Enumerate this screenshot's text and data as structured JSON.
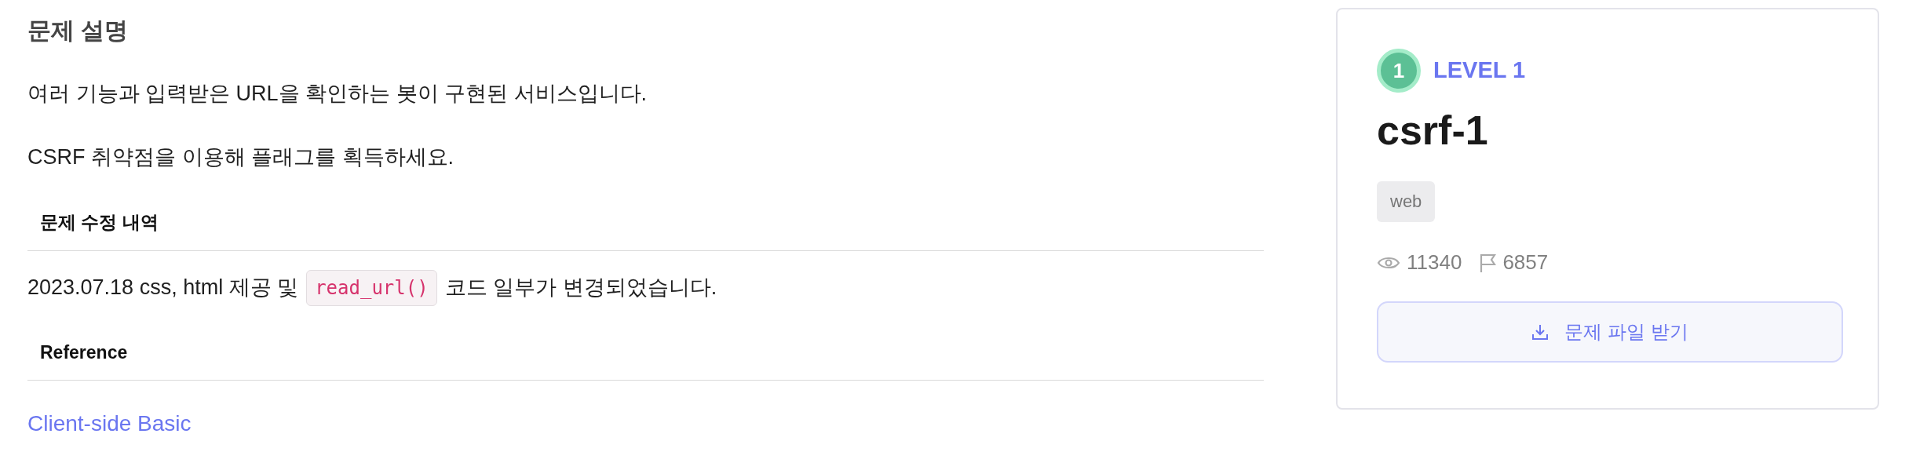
{
  "description": {
    "title": "문제 설명",
    "paragraphs": [
      "여러 기능과 입력받은 URL을 확인하는 봇이 구현된 서비스입니다.",
      "CSRF 취약점을 이용해 플래그를 획득하세요."
    ],
    "sections": [
      {
        "heading": "문제 수정 내역",
        "content": {
          "kind": "changelog",
          "before": "2023.07.18 css, html 제공 및",
          "code": "read_url()",
          "after": "코드 일부가 변경되었습니다."
        }
      },
      {
        "heading": "Reference",
        "content": {
          "kind": "link",
          "text": "Client-side Basic"
        }
      }
    ]
  },
  "card": {
    "level_number": "1",
    "level_label": "LEVEL 1",
    "title": "csrf-1",
    "tags": [
      "web"
    ],
    "views": "11340",
    "solves": "6857",
    "download_button": "문제 파일 받기"
  }
}
